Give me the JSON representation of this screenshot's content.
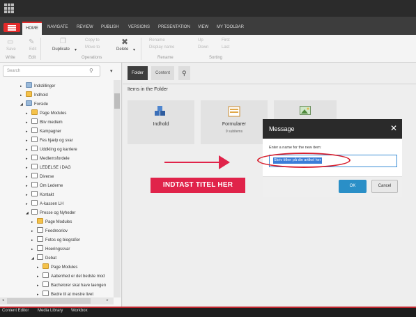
{
  "ribbon": {
    "tabs": [
      "HOME",
      "NAVIGATE",
      "REVIEW",
      "PUBLISH",
      "VERSIONS",
      "PRESENTATION",
      "VIEW",
      "MY TOOLBAR"
    ],
    "save": "Save",
    "edit": "Edit",
    "write_group": "Write",
    "edit_group": "Edit",
    "duplicate": "Duplicate",
    "copy_to": "Copy to",
    "move_to": "Move to",
    "operations_group": "Operations",
    "delete": "Delete",
    "rename": "Rename",
    "display_name": "Display name",
    "rename_group": "Rename",
    "up": "Up",
    "down": "Down",
    "first": "First",
    "last": "Last",
    "sorting_group": "Sorting"
  },
  "search": {
    "placeholder": "Search"
  },
  "tree": [
    {
      "label": "Indstillinger",
      "indent": 1,
      "toggle": "▸",
      "icon": "gear"
    },
    {
      "label": "Indhold",
      "indent": 1,
      "toggle": "▸",
      "icon": "folder"
    },
    {
      "label": "Forside",
      "indent": 1,
      "toggle": "◢",
      "icon": "home"
    },
    {
      "label": "Page Modules",
      "indent": 2,
      "toggle": "▸",
      "icon": "folder"
    },
    {
      "label": "Bliv medlem",
      "indent": 2,
      "toggle": "▸",
      "icon": "page"
    },
    {
      "label": "Kampagner",
      "indent": 2,
      "toggle": "▸",
      "icon": "page"
    },
    {
      "label": "Fes hjælp og svar",
      "indent": 2,
      "toggle": "▸",
      "icon": "page"
    },
    {
      "label": "Uddkling og karriere",
      "indent": 2,
      "toggle": "▸",
      "icon": "page"
    },
    {
      "label": "Medlemsfordele",
      "indent": 2,
      "toggle": "▸",
      "icon": "page"
    },
    {
      "label": "LEDELSE i DAG",
      "indent": 2,
      "toggle": "▸",
      "icon": "page"
    },
    {
      "label": "Diverse",
      "indent": 2,
      "toggle": "▸",
      "icon": "page"
    },
    {
      "label": "Om Lederne",
      "indent": 2,
      "toggle": "▸",
      "icon": "page"
    },
    {
      "label": "Kontakt",
      "indent": 2,
      "toggle": "▸",
      "icon": "page"
    },
    {
      "label": "A-kassen LH",
      "indent": 2,
      "toggle": "▸",
      "icon": "page"
    },
    {
      "label": "Presse og Nyheder",
      "indent": 2,
      "toggle": "◢",
      "icon": "page"
    },
    {
      "label": "Page Modules",
      "indent": 3,
      "toggle": "▸",
      "icon": "folder"
    },
    {
      "label": "Feedreoriov",
      "indent": 3,
      "toggle": "▸",
      "icon": "page"
    },
    {
      "label": "Fotos og biografier",
      "indent": 3,
      "toggle": "▸",
      "icon": "page"
    },
    {
      "label": "Hoeringssvar",
      "indent": 3,
      "toggle": "▸",
      "icon": "page"
    },
    {
      "label": "Debat",
      "indent": 3,
      "toggle": "◢",
      "icon": "page"
    },
    {
      "label": "Page Modules",
      "indent": 4,
      "toggle": "▸",
      "icon": "folder"
    },
    {
      "label": "Aabenhed er det bedste mod",
      "indent": 4,
      "toggle": "▸",
      "icon": "page"
    },
    {
      "label": "Bachelorer skal have laengen",
      "indent": 4,
      "toggle": "▸",
      "icon": "page"
    },
    {
      "label": "Bedre til at mestre livet",
      "indent": 4,
      "toggle": "▸",
      "icon": "page"
    }
  ],
  "content_tabs": {
    "folder": "Folder",
    "content": "Content"
  },
  "items_title": "Items in the Folder",
  "cards": [
    {
      "label": "Indhold",
      "sub": ""
    },
    {
      "label": "Formularer",
      "sub": "9 subitems"
    },
    {
      "label": "",
      "sub": ""
    }
  ],
  "annotation": {
    "banner": "INDTAST TITEL HER"
  },
  "dialog": {
    "title": "Message",
    "prompt": "Enter a name for the new item:",
    "value": "Skriv titlen på din artikel her",
    "ok": "OK",
    "cancel": "Cancel"
  },
  "bottom_tabs": [
    "Content Editor",
    "Media Library",
    "Workbox"
  ],
  "colors": {
    "accent": "#e32a2a",
    "annotation": "#e0234a",
    "ok_button": "#2a8fc7"
  }
}
